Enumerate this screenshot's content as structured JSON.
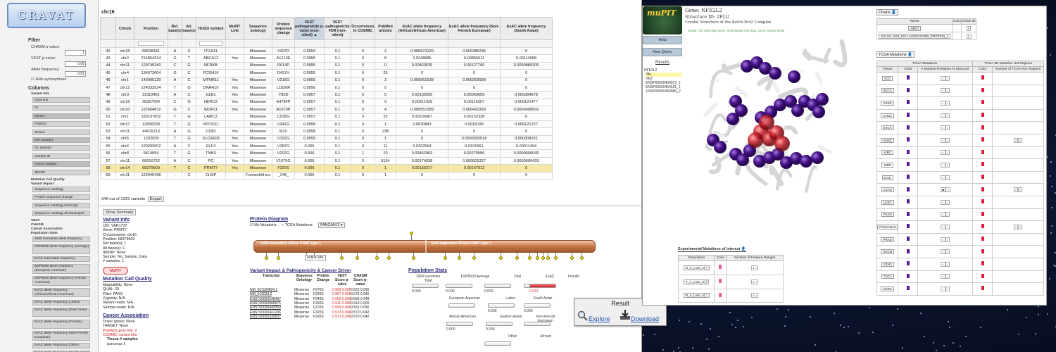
{
  "background": {
    "color": "#0c1530"
  },
  "cravat": {
    "logo_text": "CRAVAT",
    "filter": {
      "heading": "Filter",
      "fields": [
        {
          "label": "CHASM p-value:",
          "value": "1"
        },
        {
          "label": "VEST p-value:",
          "value": "0.05"
        },
        {
          "label": "Allele frequency:",
          "value": "0.01"
        }
      ],
      "hide_synonymous": "Hide synonymous"
    },
    "columns": {
      "heading": "Columns",
      "variant_info_label": "Variant Info",
      "variant_info_items": [
        "Input line",
        "ID",
        "Chrom",
        "Position",
        "Strand",
        "Ref. base(s)",
        "Alt. base(s)",
        "Sample ID",
        "HUGO symbol",
        "dbSNP"
      ],
      "mutation_call_label": "Mutation Call Quality",
      "variant_impact_label": "Variant Impact",
      "impact_items": [
        "Sequence ontology",
        "Protein sequence change",
        "Sequence ontology transcript",
        "Sequence ontology all transcripts"
      ],
      "vest_labels": [
        "VEST",
        "CHASM",
        "Cancer Association",
        "Population Stats"
      ],
      "pop_items": [
        "1000 Genomes allele frequency",
        "ESP6500 allele frequency (average)",
        "ExAC total allele frequency",
        "ESP6500 allele frequency (European American)",
        "ESP6500 allele frequency (African American)",
        "ExAC allele frequency (African/African American)",
        "ExAC allele frequency (Latino)",
        "ExAC allele frequency (East Asian)",
        "ExAC allele frequency (Finnish)",
        "ExAC allele frequency (Non-Finnish European)",
        "ExAC allele frequency (Other)",
        "ExAC allele frequency (South Asian)"
      ]
    },
    "table": {
      "title": "chr16",
      "headers": [
        "",
        "Chrom",
        "Position",
        "Ref. base(s)",
        "Alt. base(s)",
        "HUGO symbol",
        "MuPIT Link",
        "Sequence ontology",
        "Protein sequence change",
        "VEST pathogenicity p-value (non-silent) ▲",
        "VEST pathogenicity FDR (non-silent)",
        "Occurrences in COSMIC",
        "PubMed articles",
        "ExAC allele frequency (African/African American)",
        "ExAC allele frequency (Non-Finnish European)",
        "ExAC allele frequency (South Asian)"
      ],
      "rows": [
        [
          "42",
          "chr15",
          "68628181",
          "A",
          "C",
          "ITGA11",
          "",
          "Missense",
          "Y427D",
          "0.0054",
          "0.1",
          "0",
          "2",
          "0.000673129",
          "0.000385236",
          "0"
        ],
        [
          "43",
          "chr2",
          "215854314",
          "G",
          "T",
          "ABCA12",
          "Yes",
          "Missense",
          "A1219E",
          "0.0055",
          "0.1",
          "0",
          "8",
          "0.0248685",
          "0.00855611",
          "0.00114068"
        ],
        [
          "44",
          "chr11",
          "129745340",
          "C",
          "G",
          "NFRKB",
          "",
          "Missense",
          "R614P",
          "0.0055",
          "0.1",
          "0",
          "0",
          "0.00463535",
          "0.00127766",
          "0.0000889205"
        ],
        [
          "45",
          "chr4",
          "134072604",
          "G",
          "C",
          "PCDH10",
          "",
          "Missense",
          "D437H",
          "0.0055",
          "0.1",
          "0",
          "25",
          "0",
          "0",
          "0"
        ],
        [
          "46",
          "chr1",
          "149905120",
          "A",
          "C",
          "MTMR11",
          "Yes",
          "Missense",
          "V216G",
          "0.0055",
          "0.1",
          "0",
          "3",
          "0.000961538",
          "0.000269938",
          "0"
        ],
        [
          "47",
          "chr12",
          "124332524",
          "T",
          "G",
          "DNAH10",
          "Yes",
          "Missense",
          "L1826R",
          "0.0056",
          "0.1",
          "0",
          "0",
          "0",
          "0",
          "0"
        ],
        [
          "48",
          "chr3",
          "33110461",
          "A",
          "C",
          "GLB1",
          "Yes",
          "Missense",
          "Y83D",
          "0.0057",
          "0.1",
          "0",
          "5",
          "0.00136555",
          "0.00069659",
          "0.000364078"
        ],
        [
          "49",
          "chr15",
          "28357064",
          "C",
          "G",
          "HERC2",
          "Yes",
          "Missense",
          "A4784P",
          "0.0057",
          "0.1",
          "0",
          "9",
          "0.00311025",
          "0.00116357",
          "0.000121477"
        ],
        [
          "50",
          "chr10",
          "122664872",
          "G",
          "C",
          "WDR11",
          "Yes",
          "Missense",
          "A1079P",
          "0.0057",
          "0.1",
          "0",
          "4",
          "0.000557289",
          "0.000420399",
          "0.0000606502"
        ],
        [
          "51",
          "chr1",
          "183197652",
          "T",
          "G",
          "LAMC2",
          "",
          "Missense",
          "C538G",
          "0.0057",
          "0.1",
          "0",
          "35",
          "0.00236967",
          "0.00152328",
          "0"
        ],
        [
          "52",
          "chr17",
          "12656230",
          "T",
          "G",
          "MYOCD",
          "",
          "Missense",
          "V342G",
          "0.0058",
          "0.1",
          "0",
          "1",
          "0.0020842",
          "0.0016199",
          "0.000121227"
        ],
        [
          "53",
          "chr11",
          "44616213",
          "A",
          "G",
          "CD82",
          "Yes",
          "Missense",
          "M1V",
          "0.0058",
          "0.1",
          "0",
          "238",
          "0",
          "0",
          "0"
        ],
        [
          "54",
          "chr5",
          "1232929",
          "T",
          "G",
          "SLC6A18",
          "Yes",
          "Missense",
          "V122G",
          "0.0059",
          "0.1",
          "0",
          "1",
          "0",
          "0.0000303518",
          "0.000308261"
        ],
        [
          "55",
          "chrX",
          "129203602",
          "A",
          "C",
          "ELF4",
          "Yes",
          "Missense",
          "V287G",
          "0.006",
          "0.1",
          "0",
          "11",
          "0.0202564",
          "0.0101561",
          "0.00311494"
        ],
        [
          "56",
          "chr8",
          "9414054",
          "T",
          "G",
          "TNKS",
          "Yes",
          "Missense",
          "V202G",
          "0.006",
          "0.1",
          "1",
          "10",
          "0.00462963",
          "0.00279556",
          "0.0000606649"
        ],
        [
          "57",
          "chr11",
          "66616762",
          "A",
          "C",
          "PC",
          "Yes",
          "Missense",
          "V1075G",
          "0.006",
          "0.1",
          "0",
          "9164",
          "0.00174038",
          "0.000605327",
          "0.0000606428"
        ],
        [
          "58",
          "chr14",
          "68379609",
          "T",
          "C",
          "PRMT7",
          "Yes",
          "Missense",
          "F320S",
          "0.006",
          "0.1",
          "0",
          "1",
          "0.00156217",
          "0.00167913",
          "0"
        ],
        [
          "59",
          "chr11",
          "122945498",
          "-",
          "C",
          "CLMP",
          "",
          "Frameshift ins",
          "_245_",
          "0.006",
          "0.1",
          "0",
          "1",
          "0",
          "0",
          "0"
        ]
      ],
      "selected_row": "58",
      "footer": "349 out of 1229 variants",
      "export_label": "Export"
    },
    "details": {
      "show_summary": "Show Summary",
      "variant_info_heading": "Variant Info",
      "variant_info": [
        "UID: VAR1737",
        "Gene: PRMT7",
        "Chromosome: chr16",
        "Position: 68379609",
        "Ref base(s): T",
        "Alt base(s): C",
        "dbSNP: None",
        "Sample: No_Sample_Data",
        "# samples: 1"
      ],
      "mupit_button": "MuPIT",
      "mcq_heading": "Mutation Call Quality",
      "mcq": [
        "Mappability: None",
        "QUAL: 25",
        "Filter: PASS",
        "Zygosity: N/A",
        "Variant reads: N/A",
        "Sample reads: N/A"
      ],
      "ca_heading": "Cancer Association",
      "ca": [
        "Driver genes: None",
        "TARGET: None"
      ],
      "ca_red": [
        "PubMed gene hits: 2",
        "COSMIC variant hits: -"
      ],
      "ca_tissue_header": "Tissue    # samples",
      "ca_tissue": "pancreas 1",
      "protein_diagram_heading": "Protein Diagram",
      "my_mutations": "My Mutations",
      "tcga_mutations": "TCGA Mutations:",
      "tcga_select": "PANCAN12",
      "domain1": "SAM-dependent MTase PRMT-type 1",
      "domain2": "SAM-dependent MTase PRMT-type 2",
      "active_site": "active site",
      "impact_heading": "Variant Impact & Pathogenicity & Cancer Driver",
      "impact_headers": [
        "Transcript",
        "Sequence Ontology",
        "Protein Change",
        "VEST Score p-value",
        "CHASM Score p-value"
      ],
      "impact_rows": [
        [
          "NM_001184824.1",
          "Missense",
          "F270S",
          "0.969 0.006",
          "0.552 0.056"
        ],
        [
          "NM_019023.2",
          "Missense",
          "F320S",
          "0.957 0.006",
          "0.576 0.042"
        ],
        [
          "ENST00000348497",
          "Missense",
          "F246S",
          "0.962 0.006",
          "0.566 0.049"
        ],
        [
          "ENST00000568975",
          "Missense",
          "F320S",
          "0.911 0.008",
          "0.610 0.000"
        ],
        [
          "ENST00000449359",
          "Missense",
          "F270S",
          "0.969 0.006",
          "0.552 0.056"
        ],
        [
          "ENST00000441236",
          "Missense",
          "F320S",
          "0.973 0.006",
          "0.570 0.042"
        ],
        [
          "ENST00000339507",
          "Missense",
          "F320S",
          "0.973 0.006",
          "0.570 0.042"
        ]
      ],
      "pop_heading": "Population Stats",
      "pop_labels": [
        "1000 Genomes Total",
        "ESP6500 Average",
        "Total",
        "ExAC",
        "Finnish",
        "European American",
        "Latino",
        "South Asian",
        "African American",
        "Eastern Asian",
        "Non-Finnish European",
        "Other",
        "African"
      ],
      "pop_values": [
        "0.000",
        "0.000",
        "0.000",
        "0.012",
        "0.000",
        "0.000",
        "0.000",
        "0.000"
      ]
    }
  },
  "result_box": {
    "title": "Result",
    "explore": "Explore",
    "download": "Download"
  },
  "mupit": {
    "logo_text": "muPIT",
    "gene": "Gene: NFE2L2",
    "structure": "Structure ID: 2FLU",
    "description": "Crystal Structure of the Kelch-Nrf2 Complex",
    "hint": "Rotate: Left click-drag, Move: Shift-double click-drag, Zoom: Mouse wheel",
    "help_button": "Help",
    "new_query_button": "New Query",
    "results_heading": "Results",
    "results_items": [
      "NFE2L2",
      "2flu",
      "nfe2",
      "ENSP00000400073_1",
      "ENSP00000454521_1",
      "ENSP00000468989_2"
    ],
    "chains_label": "Chains",
    "chains_headers": [
      "Name",
      "Color",
      "Chain ID"
    ],
    "chains_rows": [
      [
        "NRF2",
        "F"
      ],
      [
        "KELCH-LIKE_ECH-ASSOCIATED_PROTEIN_1",
        "X"
      ]
    ],
    "tcga_label": "TCGA Mutations",
    "tcga_headers": [
      "Tissue",
      "Color",
      "# Mutated Residues in Structure",
      "Color",
      "Number of TCGA Hot Regions"
    ],
    "tcga_group_headers": [
      "TCGA Mutations",
      "TCGA 3D Mutation Hot Regions"
    ],
    "tcga_rows": [
      "ACC",
      "BLCA",
      "CESC",
      "CHOL",
      "ESCA",
      "HNSC",
      "KIRC",
      "KIRP",
      "LIHC",
      "LUAD",
      "LUSC",
      "PAAD",
      "PANCAN12",
      "PRAD",
      "SKCM",
      "STAD",
      "THCA",
      "UCEC"
    ],
    "exp_heading": "Experimental Mutations of Interest",
    "exp_headers": [
      "Description",
      "Color",
      "Number of Feature Ranges"
    ],
    "exp_rows": [
      "R_A_Loss_of_f",
      "T_A_Loss_of_f",
      "R_A_Loss_of_f"
    ],
    "colors": {
      "purple": "#5a1a9a",
      "red": "#e01e3c",
      "pink": "#e35a9e"
    }
  }
}
